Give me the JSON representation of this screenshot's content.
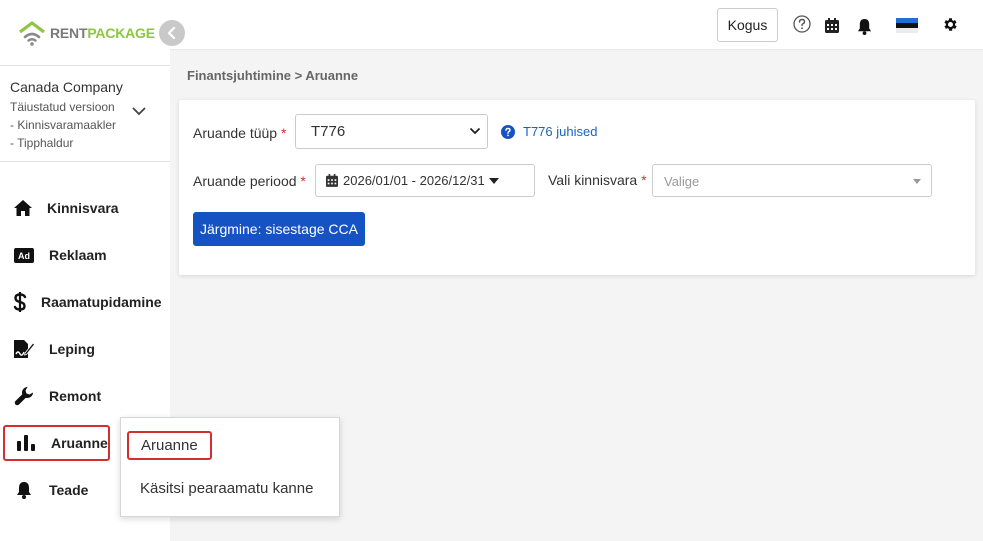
{
  "logo": {
    "part1": "RENT",
    "part2": "PACKAGE"
  },
  "company": {
    "name": "Canada Company",
    "lines": [
      "Täiustatud versioon",
      "- Kinnisvaramaakler",
      "- Tipphaldur"
    ]
  },
  "nav": {
    "items": [
      {
        "label": "Kinnisvara",
        "icon": "home-icon"
      },
      {
        "label": "Reklaam",
        "icon": "ad-icon"
      },
      {
        "label": "Raamatupidamine",
        "icon": "dollar-icon"
      },
      {
        "label": "Leping",
        "icon": "contract-icon"
      },
      {
        "label": "Remont",
        "icon": "wrench-icon"
      },
      {
        "label": "Aruanne",
        "icon": "bar-chart-icon"
      },
      {
        "label": "Teade",
        "icon": "bell-icon"
      }
    ],
    "active": "Aruanne"
  },
  "submenu": {
    "items": [
      "Aruanne",
      "Käsitsi pearaamatu kanne"
    ]
  },
  "topbar": {
    "kogus_label": "Kogus"
  },
  "breadcrumb": "Finantsjuhtimine > Aruanne",
  "form": {
    "report_type_label": "Aruande tüüp",
    "report_type_value": "T776",
    "required_mark": "*",
    "help_link": "T776 juhised",
    "period_label": "Aruande periood",
    "period_value": "2026/01/01 - 2026/12/31",
    "property_label": "Vali kinnisvara",
    "property_placeholder": "Valige",
    "next_button": "Järgmine: sisestage CCA"
  },
  "colors": {
    "primary": "#1552c4",
    "highlight": "#d32f2f",
    "link": "#1565c0",
    "logo_green": "#8dc63f"
  }
}
